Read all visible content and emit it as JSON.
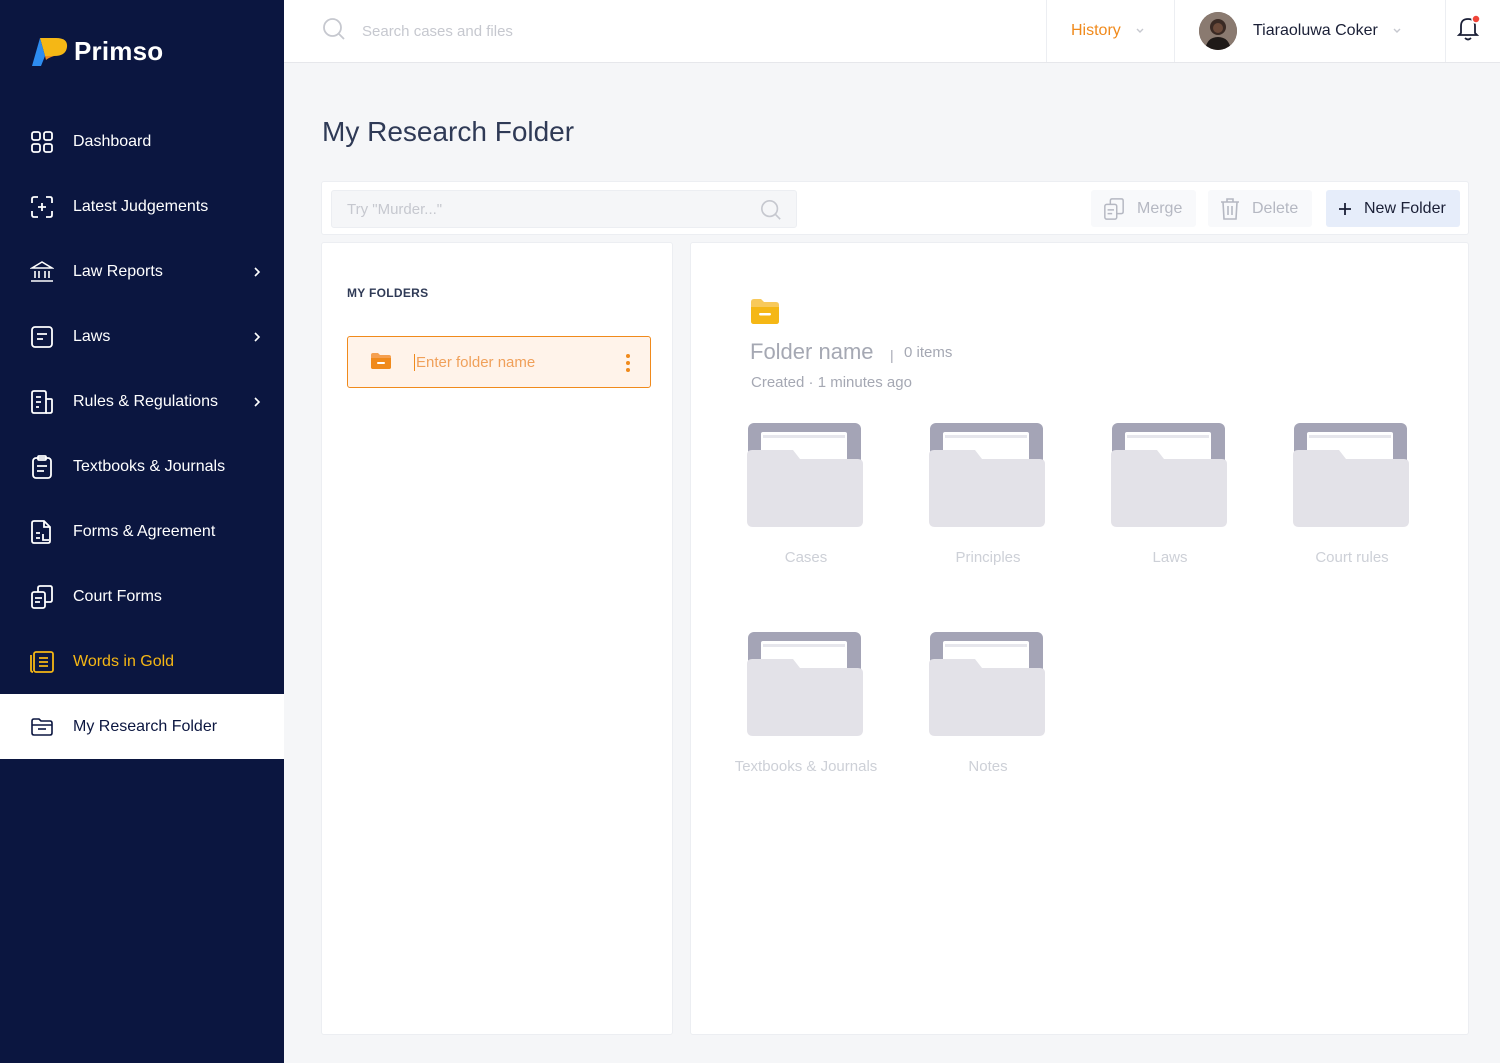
{
  "brand": {
    "name": "Primso",
    "colors": {
      "sidebar": "#0b1640",
      "accent": "#f08a1c",
      "gold": "#f5b715"
    }
  },
  "sidebar": {
    "items": [
      {
        "label": "Dashboard",
        "icon": "grid-icon"
      },
      {
        "label": "Latest Judgements",
        "icon": "scan-plus-icon"
      },
      {
        "label": "Law Reports",
        "icon": "bank-icon",
        "has_submenu": true
      },
      {
        "label": "Laws",
        "icon": "document-icon",
        "has_submenu": true
      },
      {
        "label": "Rules & Regulations",
        "icon": "rules-icon",
        "has_submenu": true
      },
      {
        "label": "Textbooks & Journals",
        "icon": "clipboard-icon"
      },
      {
        "label": "Forms & Agreement",
        "icon": "form-icon"
      },
      {
        "label": "Court Forms",
        "icon": "copy-icon"
      },
      {
        "label": "Words in Gold",
        "icon": "list-icon",
        "highlight": "gold"
      },
      {
        "label": "My Research Folder",
        "icon": "folder-icon",
        "active": true
      }
    ]
  },
  "topbar": {
    "search_placeholder": "Search cases and files",
    "history_label": "History",
    "user_name": "Tiaraoluwa Coker"
  },
  "page": {
    "title": "My Research Folder"
  },
  "toolbar": {
    "search_placeholder": "Try \"Murder...\"",
    "merge_label": "Merge",
    "delete_label": "Delete",
    "new_folder_label": "New Folder"
  },
  "folders_panel": {
    "heading": "MY FOLDERS",
    "input_placeholder": "Enter folder name"
  },
  "detail": {
    "folder_name": "Folder name",
    "separator": "|",
    "items_count": "0 items",
    "created": "Created · 1 minutes ago",
    "subfolders": [
      "Cases",
      "Principles",
      "Laws",
      "Court rules",
      "Textbooks &  Journals",
      "Notes"
    ]
  }
}
